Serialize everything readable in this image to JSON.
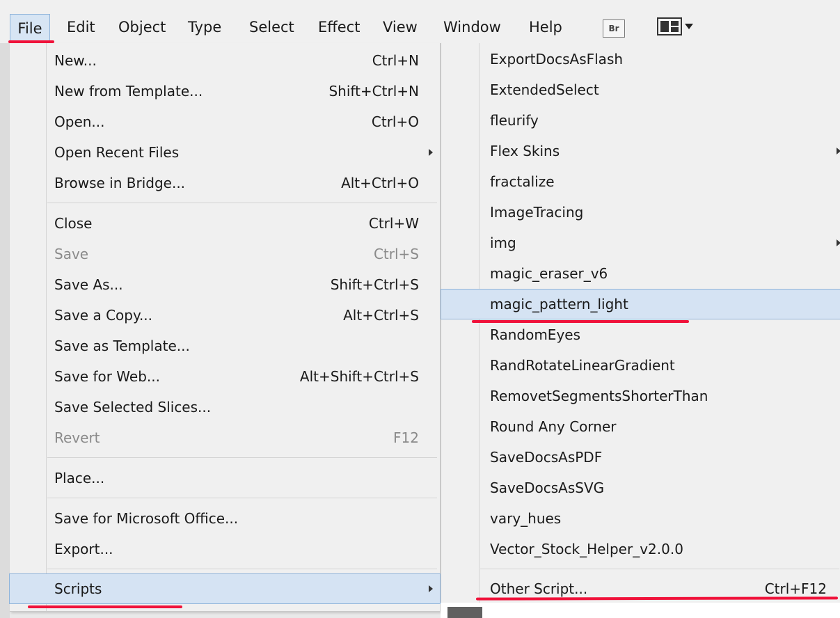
{
  "menubar": {
    "items": [
      "File",
      "Edit",
      "Object",
      "Type",
      "Select",
      "Effect",
      "View",
      "Window",
      "Help"
    ],
    "bridge_label": "Br",
    "workspace_icon": "workspace-switcher-icon"
  },
  "file_menu": {
    "items": [
      {
        "label": "New...",
        "shortcut": "Ctrl+N"
      },
      {
        "label": "New from Template...",
        "shortcut": "Shift+Ctrl+N"
      },
      {
        "label": "Open...",
        "shortcut": "Ctrl+O"
      },
      {
        "label": "Open Recent Files",
        "shortcut": ""
      },
      {
        "label": "Browse in Bridge...",
        "shortcut": "Alt+Ctrl+O"
      },
      {
        "label": "Close",
        "shortcut": "Ctrl+W"
      },
      {
        "label": "Save",
        "shortcut": "Ctrl+S"
      },
      {
        "label": "Save As...",
        "shortcut": "Shift+Ctrl+S"
      },
      {
        "label": "Save a Copy...",
        "shortcut": "Alt+Ctrl+S"
      },
      {
        "label": "Save as Template...",
        "shortcut": ""
      },
      {
        "label": "Save for Web...",
        "shortcut": "Alt+Shift+Ctrl+S"
      },
      {
        "label": "Save Selected Slices...",
        "shortcut": ""
      },
      {
        "label": "Revert",
        "shortcut": "F12"
      },
      {
        "label": "Place...",
        "shortcut": ""
      },
      {
        "label": "Save for Microsoft Office...",
        "shortcut": ""
      },
      {
        "label": "Export...",
        "shortcut": ""
      },
      {
        "label": "Scripts",
        "shortcut": ""
      }
    ]
  },
  "scripts_menu": {
    "items": [
      {
        "label": "ExportDocsAsFlash",
        "shortcut": ""
      },
      {
        "label": "ExtendedSelect",
        "shortcut": ""
      },
      {
        "label": "fleurify",
        "shortcut": ""
      },
      {
        "label": "Flex Skins",
        "shortcut": ""
      },
      {
        "label": "fractalize",
        "shortcut": ""
      },
      {
        "label": "ImageTracing",
        "shortcut": ""
      },
      {
        "label": "img",
        "shortcut": ""
      },
      {
        "label": "magic_eraser_v6",
        "shortcut": ""
      },
      {
        "label": "magic_pattern_light",
        "shortcut": ""
      },
      {
        "label": "RandomEyes",
        "shortcut": ""
      },
      {
        "label": "RandRotateLinearGradient",
        "shortcut": ""
      },
      {
        "label": "RemovetSegmentsShorterThan",
        "shortcut": ""
      },
      {
        "label": "Round Any Corner",
        "shortcut": ""
      },
      {
        "label": "SaveDocsAsPDF",
        "shortcut": ""
      },
      {
        "label": "SaveDocsAsSVG",
        "shortcut": ""
      },
      {
        "label": "vary_hues",
        "shortcut": ""
      },
      {
        "label": "Vector_Stock_Helper_v2.0.0",
        "shortcut": ""
      },
      {
        "label": "Other Script...",
        "shortcut": "Ctrl+F12"
      }
    ]
  },
  "colors": {
    "highlight": "#d5e3f3",
    "highlight_border": "#8fb4da",
    "annotation_red": "#f0123a"
  }
}
